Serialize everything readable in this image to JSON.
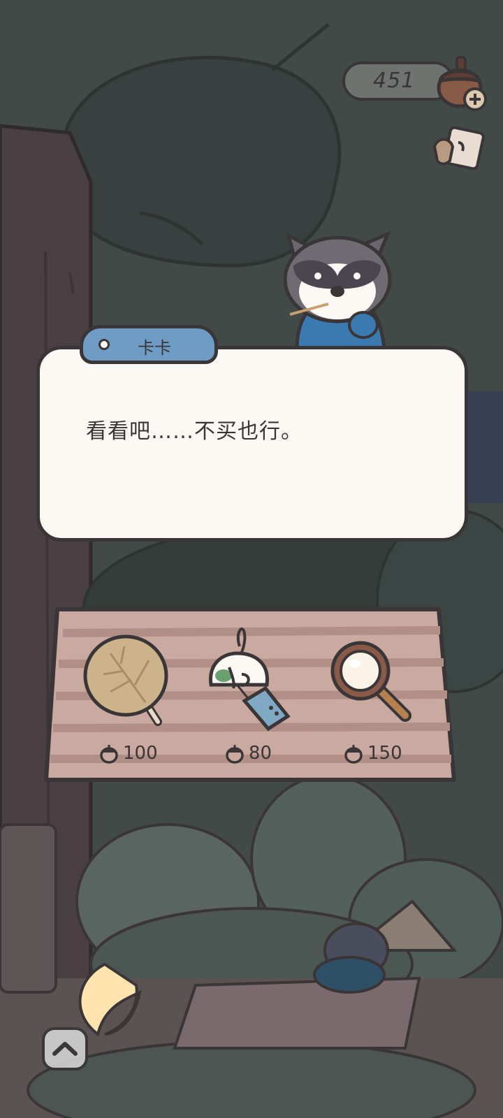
{
  "hud": {
    "currency_amount": "451",
    "currency_icon": "acorn-icon",
    "add_icon": "plus-icon",
    "swap_icon": "flip-card-icon"
  },
  "dialog": {
    "speaker": "卡卡",
    "text": "看看吧……不买也行。"
  },
  "shop": {
    "items": [
      {
        "icon": "leaf-fan-icon",
        "price": "100"
      },
      {
        "icon": "wind-chime-icon",
        "price": "80"
      },
      {
        "icon": "magnifying-glass-icon",
        "price": "150"
      }
    ]
  },
  "controls": {
    "collapse_icon": "chevron-up-icon"
  },
  "colors": {
    "background": "#3f4746",
    "outline": "#3a3536",
    "dialog_bg": "#fcf8f4",
    "name_tag": "#6e9cc5",
    "board": "#c9a9a0",
    "currency_pill": "#6e7370"
  }
}
